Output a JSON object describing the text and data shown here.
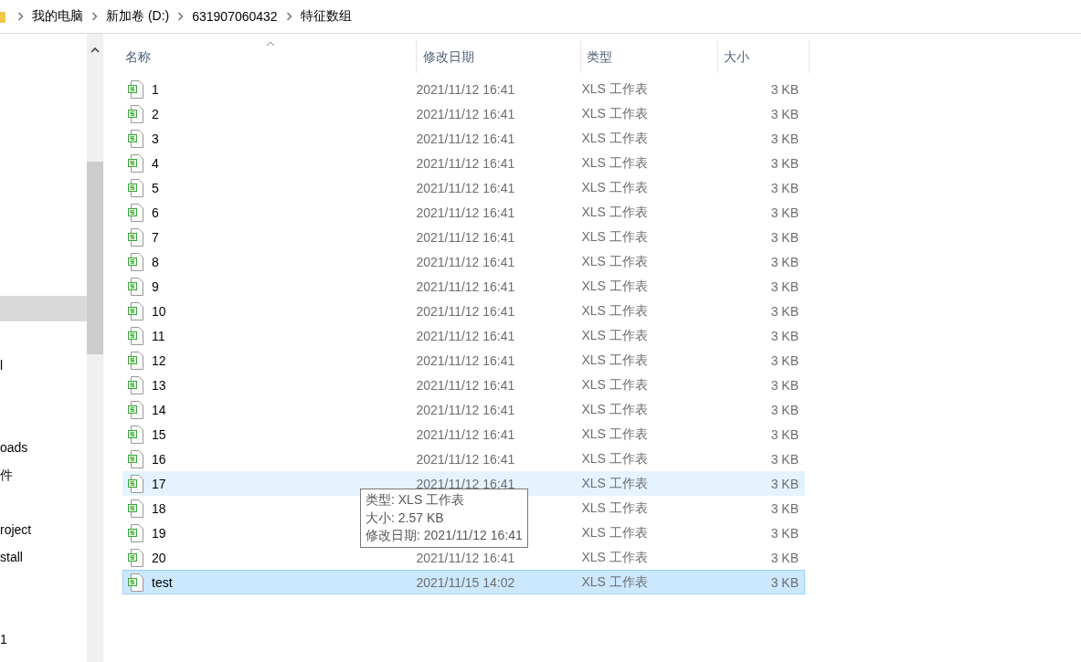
{
  "breadcrumb": [
    "我的电脑",
    "新加卷 (D:)",
    "631907060432",
    "特征数组"
  ],
  "sidebar": {
    "items": [
      {
        "selected": true
      },
      {
        "selected": false
      },
      {
        "label": "l",
        "selected": false
      },
      {
        "selected": false
      },
      {
        "selected": false
      },
      {
        "label": "oads",
        "selected": false
      },
      {
        "label": "件",
        "selected": false
      },
      {
        "selected": false
      },
      {
        "label": "roject",
        "selected": false
      },
      {
        "label": "stall",
        "selected": false
      },
      {
        "selected": false
      },
      {
        "selected": false
      },
      {
        "label": "1",
        "selected": false
      }
    ]
  },
  "table": {
    "columns": [
      {
        "label": "名称",
        "sorted": true
      },
      {
        "label": "修改日期",
        "sorted": false
      },
      {
        "label": "类型",
        "sorted": false
      },
      {
        "label": "大小",
        "sorted": false
      }
    ],
    "rows": [
      {
        "name": "1",
        "modified": "2021/11/12 16:41",
        "type": "XLS 工作表",
        "size": "3 KB",
        "selected": false,
        "hovered": false
      },
      {
        "name": "2",
        "modified": "2021/11/12 16:41",
        "type": "XLS 工作表",
        "size": "3 KB",
        "selected": false,
        "hovered": false
      },
      {
        "name": "3",
        "modified": "2021/11/12 16:41",
        "type": "XLS 工作表",
        "size": "3 KB",
        "selected": false,
        "hovered": false
      },
      {
        "name": "4",
        "modified": "2021/11/12 16:41",
        "type": "XLS 工作表",
        "size": "3 KB",
        "selected": false,
        "hovered": false
      },
      {
        "name": "5",
        "modified": "2021/11/12 16:41",
        "type": "XLS 工作表",
        "size": "3 KB",
        "selected": false,
        "hovered": false
      },
      {
        "name": "6",
        "modified": "2021/11/12 16:41",
        "type": "XLS 工作表",
        "size": "3 KB",
        "selected": false,
        "hovered": false
      },
      {
        "name": "7",
        "modified": "2021/11/12 16:41",
        "type": "XLS 工作表",
        "size": "3 KB",
        "selected": false,
        "hovered": false
      },
      {
        "name": "8",
        "modified": "2021/11/12 16:41",
        "type": "XLS 工作表",
        "size": "3 KB",
        "selected": false,
        "hovered": false
      },
      {
        "name": "9",
        "modified": "2021/11/12 16:41",
        "type": "XLS 工作表",
        "size": "3 KB",
        "selected": false,
        "hovered": false
      },
      {
        "name": "10",
        "modified": "2021/11/12 16:41",
        "type": "XLS 工作表",
        "size": "3 KB",
        "selected": false,
        "hovered": false
      },
      {
        "name": "11",
        "modified": "2021/11/12 16:41",
        "type": "XLS 工作表",
        "size": "3 KB",
        "selected": false,
        "hovered": false
      },
      {
        "name": "12",
        "modified": "2021/11/12 16:41",
        "type": "XLS 工作表",
        "size": "3 KB",
        "selected": false,
        "hovered": false
      },
      {
        "name": "13",
        "modified": "2021/11/12 16:41",
        "type": "XLS 工作表",
        "size": "3 KB",
        "selected": false,
        "hovered": false
      },
      {
        "name": "14",
        "modified": "2021/11/12 16:41",
        "type": "XLS 工作表",
        "size": "3 KB",
        "selected": false,
        "hovered": false
      },
      {
        "name": "15",
        "modified": "2021/11/12 16:41",
        "type": "XLS 工作表",
        "size": "3 KB",
        "selected": false,
        "hovered": false
      },
      {
        "name": "16",
        "modified": "2021/11/12 16:41",
        "type": "XLS 工作表",
        "size": "3 KB",
        "selected": false,
        "hovered": false
      },
      {
        "name": "17",
        "modified": "2021/11/12 16:41",
        "type": "XLS 工作表",
        "size": "3 KB",
        "selected": false,
        "hovered": true
      },
      {
        "name": "18",
        "type": "XLS 工作表",
        "size": "3 KB",
        "selected": false,
        "hovered": false
      },
      {
        "name": "19",
        "type": "XLS 工作表",
        "size": "3 KB",
        "selected": false,
        "hovered": false
      },
      {
        "name": "20",
        "modified": "2021/11/12 16:41",
        "type": "XLS 工作表",
        "size": "3 KB",
        "selected": false,
        "hovered": false
      },
      {
        "name": "test",
        "modified": "2021/11/15 14:02",
        "type": "XLS 工作表",
        "size": "3 KB",
        "selected": true,
        "hovered": false
      }
    ]
  },
  "tooltip": [
    "类型: XLS 工作表",
    "大小: 2.57 KB",
    "修改日期: 2021/11/12 16:41"
  ]
}
